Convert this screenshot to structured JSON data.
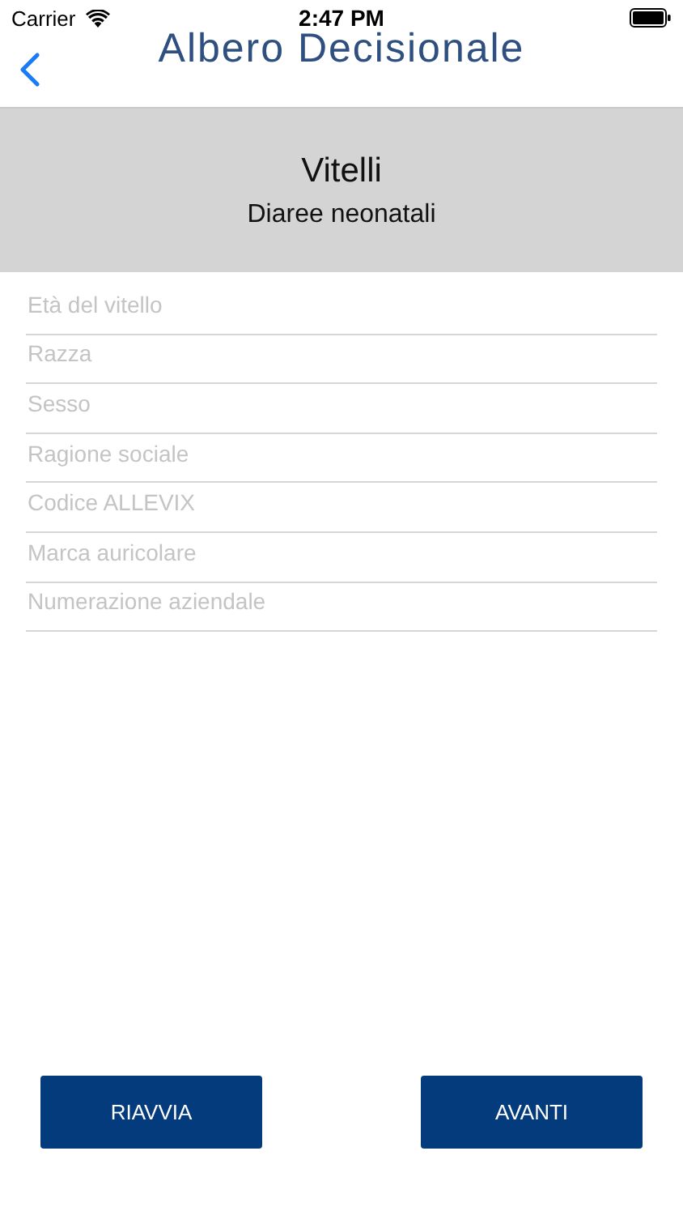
{
  "status_bar": {
    "carrier": "Carrier",
    "time": "2:47 PM"
  },
  "nav": {
    "title": "Albero Decisionale"
  },
  "header": {
    "title": "Vitelli",
    "subtitle": "Diaree neonatali"
  },
  "fields": [
    {
      "placeholder": "Età del vitello"
    },
    {
      "placeholder": "Razza"
    },
    {
      "placeholder": "Sesso"
    },
    {
      "placeholder": "Ragione sociale"
    },
    {
      "placeholder": "Codice ALLEVIX"
    },
    {
      "placeholder": "Marca auricolare"
    },
    {
      "placeholder": "Numerazione aziendale"
    }
  ],
  "buttons": [
    "RIAVVIA",
    "AVANTI"
  ]
}
